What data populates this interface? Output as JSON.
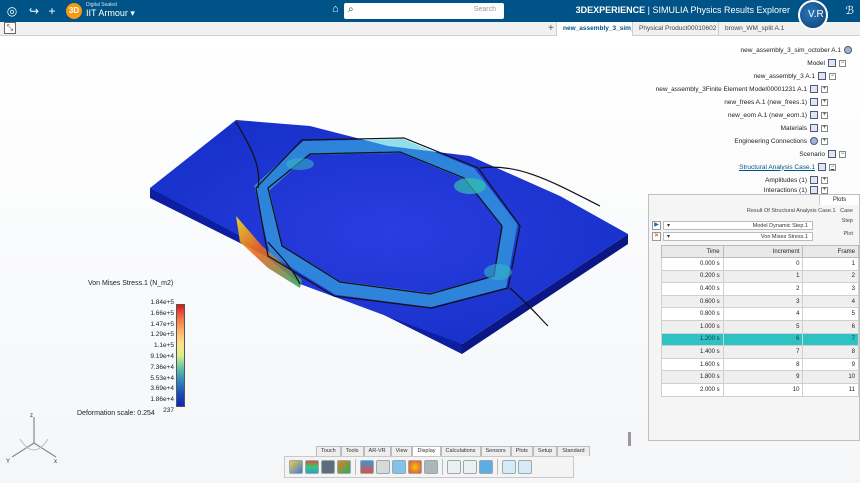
{
  "topbar": {
    "user_sub": "Digital Sealed",
    "user_name": "IIT Armour",
    "badge": "3D",
    "search_placeholder": "Search",
    "app_brand": "3DEXPERIENCE",
    "app_sep": " | ",
    "app_name": "SIMULIA Physics Results Explorer",
    "compass_label": "V.R",
    "icons": [
      "compass-3d-icon",
      "share-icon",
      "add-icon",
      "tag-icon",
      "search-icon",
      "ds-logo-icon"
    ]
  },
  "tabs": [
    "new_assembly_3_sim_octobe...",
    "Physical Product00010602",
    "brown_WM_split A.1"
  ],
  "tree": [
    {
      "label": "new_assembly_3_sim_october A.1",
      "icon": "sim"
    },
    {
      "label": "Model",
      "icon": "model"
    },
    {
      "label": "new_assembly_3 A.1",
      "icon": "product"
    },
    {
      "label": "new_assembly_3Finite Element Model00001231 A.1",
      "icon": "fem"
    },
    {
      "label": "new_frees A.1 (new_frees.1)",
      "icon": "part"
    },
    {
      "label": "new_eom A.1 (new_eom.1)",
      "icon": "part"
    },
    {
      "label": "Materials",
      "icon": "materials"
    },
    {
      "label": "Engineering Connections",
      "icon": "connections"
    },
    {
      "label": "Scenario",
      "icon": "scenario"
    },
    {
      "label": "Structural Analysis Case.1",
      "icon": "case"
    },
    {
      "label": "Amplitudes (1)",
      "icon": "amplitude"
    },
    {
      "label": "Interactions (1)",
      "icon": "interaction"
    }
  ],
  "plots": {
    "tab_label": "Plots",
    "case_label": "Case",
    "case_value": "Result Of Structural Analysis Case.1",
    "step_label": "Step",
    "step_value": "Model Dynamic Step.1",
    "plot_label": "Plot",
    "plot_value": "Von Mises Stress.1",
    "columns": [
      "Frame",
      "Increment",
      "Time"
    ],
    "rows": [
      [
        "1",
        "0",
        "0.000 s"
      ],
      [
        "2",
        "1",
        "0.200 s"
      ],
      [
        "3",
        "2",
        "0.400 s"
      ],
      [
        "4",
        "3",
        "0.600 s"
      ],
      [
        "5",
        "4",
        "0.800 s"
      ],
      [
        "6",
        "5",
        "1.000 s"
      ],
      [
        "7",
        "6",
        "1.200 s"
      ],
      [
        "8",
        "7",
        "1.400 s"
      ],
      [
        "9",
        "8",
        "1.600 s"
      ],
      [
        "10",
        "9",
        "1.800 s"
      ],
      [
        "11",
        "10",
        "2.000 s"
      ]
    ],
    "selected_frame": "7"
  },
  "legend": {
    "title": "Von Mises Stress.1 (N_m2)",
    "values": [
      "1.84e+5",
      "1.66e+5",
      "1.47e+5",
      "1.29e+5",
      "1.1e+5",
      "9.19e+4",
      "7.36e+4",
      "5.53e+4",
      "3.69e+4",
      "1.86e+4",
      "237"
    ],
    "deformation": "Deformation scale: 0.254",
    "colors": [
      "#d7191c",
      "#f46d43",
      "#fdae61",
      "#fee08b",
      "#66c2a5",
      "#3288bd",
      "#1020c0"
    ]
  },
  "triad": {
    "x": "x",
    "y": "Y",
    "z": "z"
  },
  "bottom_tabs": [
    "Standard",
    "Setup",
    "Plots",
    "Sensors",
    "Calculations",
    "Display",
    "View",
    "AR-VR",
    "Tools",
    "Touch"
  ],
  "active_bottom_tab": "Display"
}
